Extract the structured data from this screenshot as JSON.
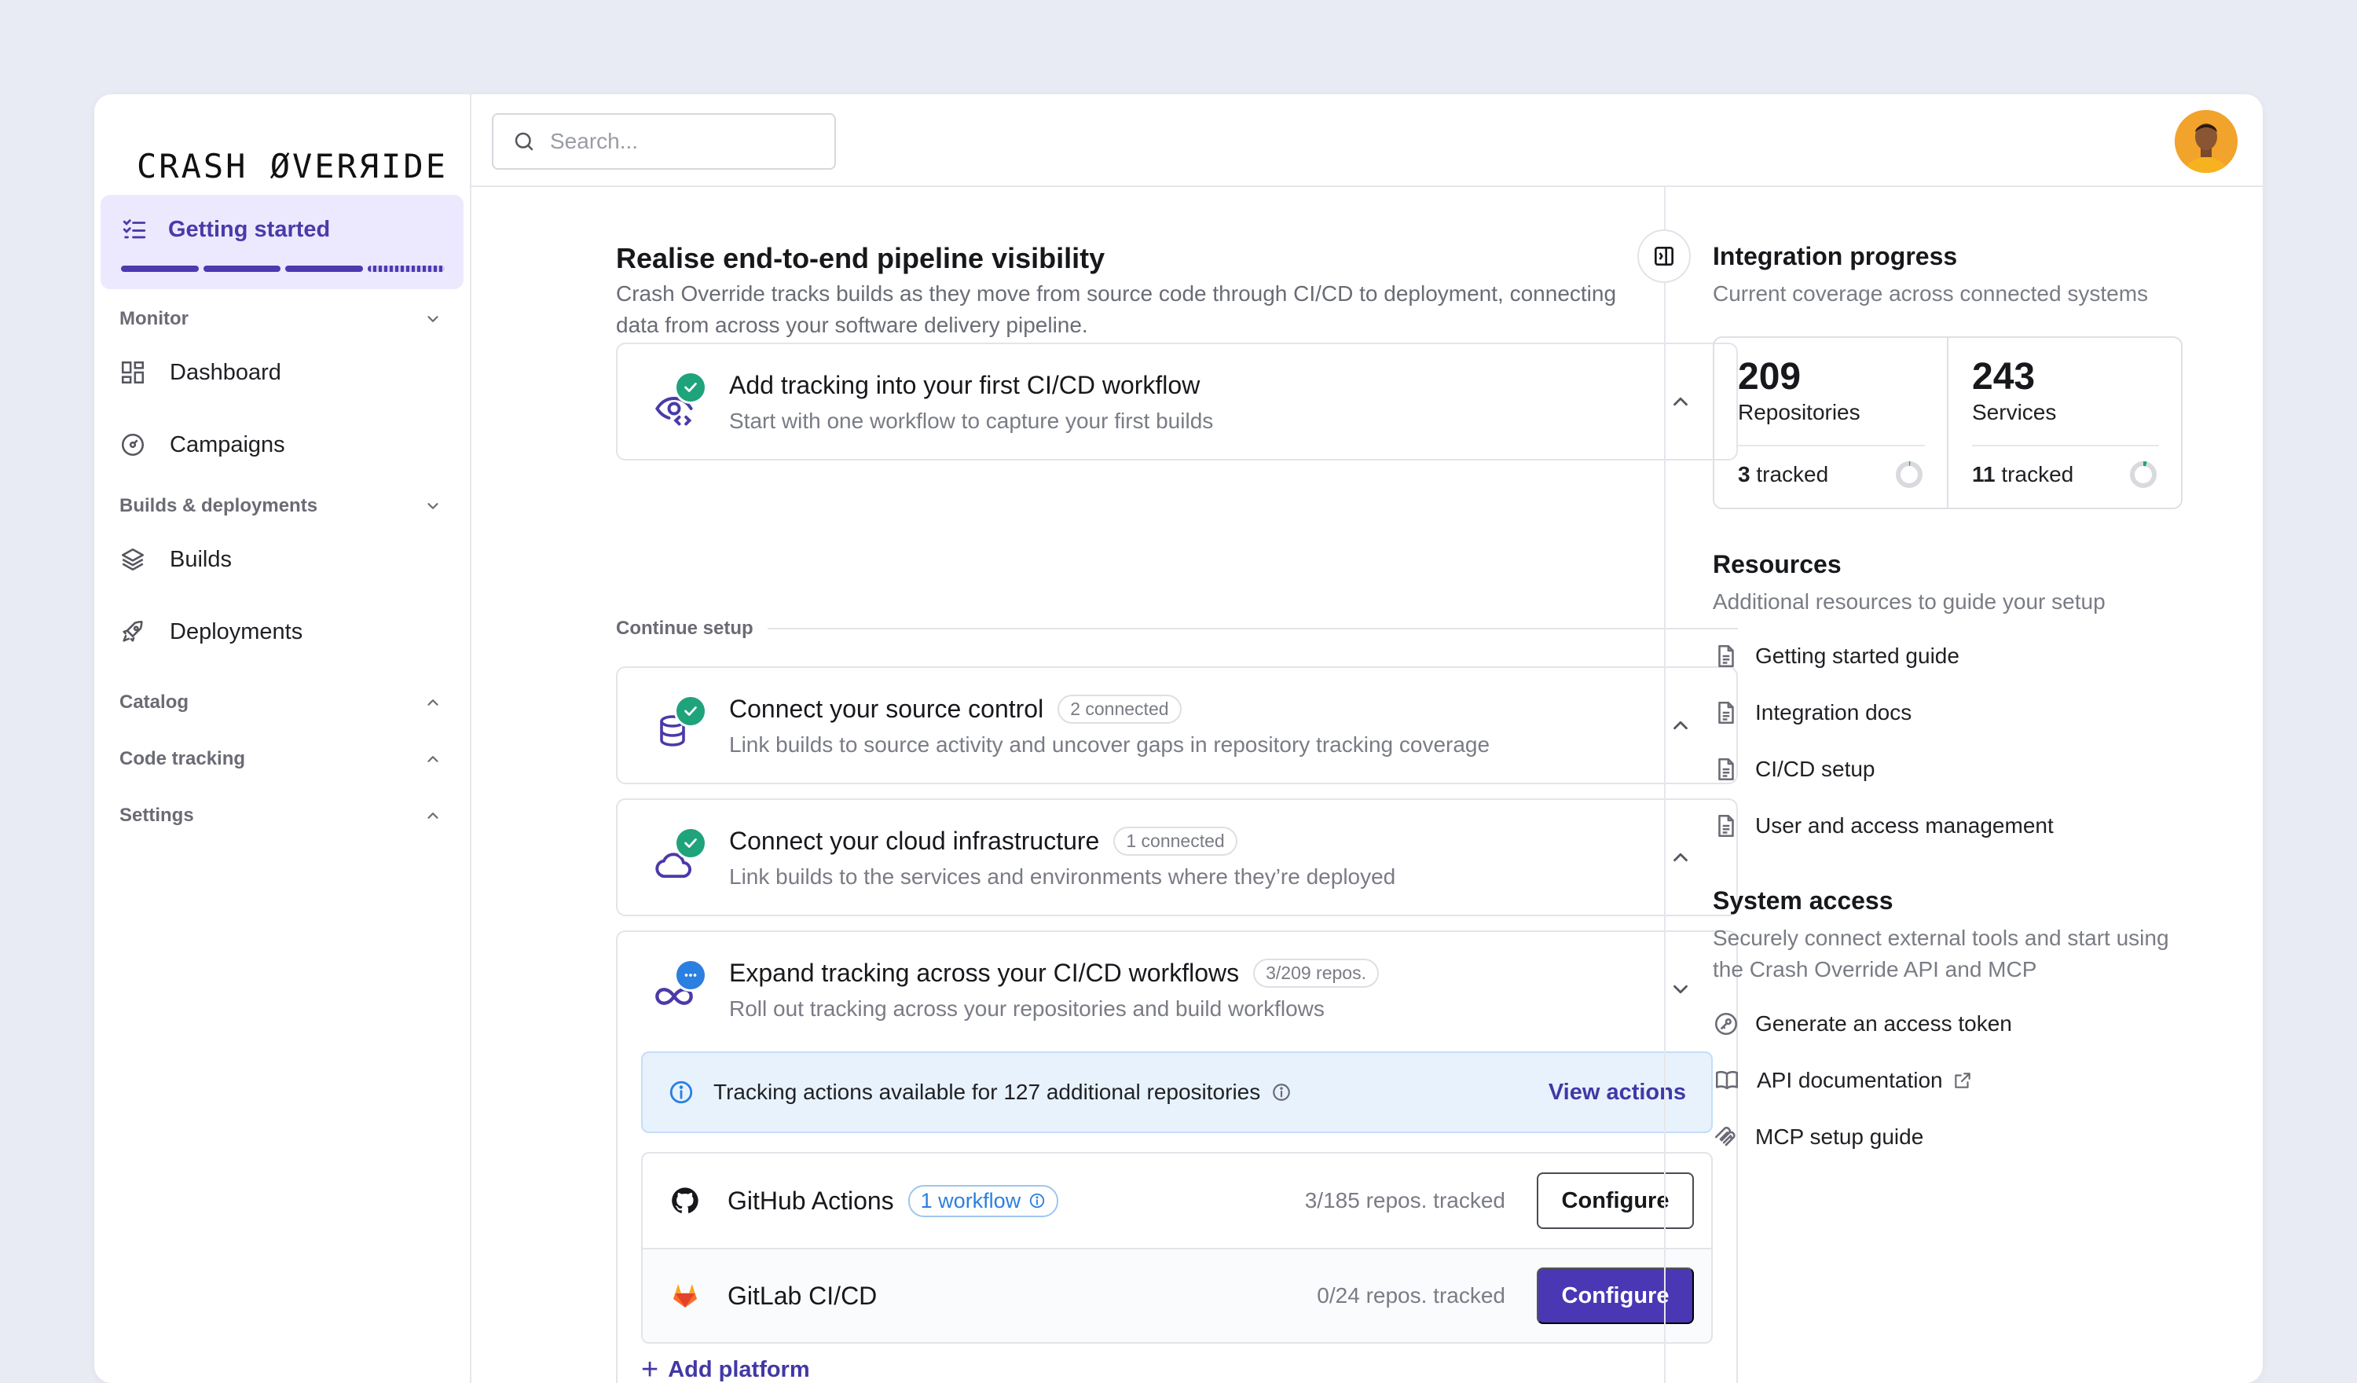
{
  "brand": "CRASH ØVERЯIDE",
  "sidebar": {
    "getting_started": "Getting started",
    "progress": {
      "completed_segments": 3,
      "total_segments": 4
    },
    "sections": [
      {
        "label": "Monitor",
        "items": [
          "Dashboard",
          "Campaigns"
        ]
      },
      {
        "label": "Builds & deployments",
        "items": [
          "Builds",
          "Deployments"
        ]
      },
      {
        "label": "Catalog"
      },
      {
        "label": "Code tracking"
      },
      {
        "label": "Settings"
      }
    ]
  },
  "search": {
    "placeholder": "Search..."
  },
  "main": {
    "title": "Realise end-to-end pipeline visibility",
    "description": "Crash Override tracks builds as they move from source code through CI/CD to deployment, connecting data from across your software delivery pipeline.",
    "first_step": {
      "title": "Add tracking into your first CI/CD workflow",
      "subtitle": "Start with one workflow to capture your first builds"
    },
    "continue_label": "Continue setup",
    "steps": [
      {
        "title": "Connect your source control",
        "badge": "2 connected",
        "subtitle": "Link builds to source activity and uncover gaps in repository tracking coverage"
      },
      {
        "title": "Connect your cloud infrastructure",
        "badge": "1 connected",
        "subtitle": "Link builds to the services and environments where they’re deployed"
      },
      {
        "title": "Expand tracking across your CI/CD workflows",
        "badge": "3/209 repos.",
        "subtitle": "Roll out tracking across your repositories and build workflows"
      }
    ],
    "info_banner": {
      "text": "Tracking actions available for 127 additional repositories",
      "link": "View actions"
    },
    "platforms": [
      {
        "name": "GitHub Actions",
        "workflow_badge": "1 workflow",
        "count": "3/185 repos. tracked",
        "button": "Configure"
      },
      {
        "name": "GitLab CI/CD",
        "count": "0/24 repos. tracked",
        "button": "Configure"
      }
    ],
    "add_platform": "Add platform"
  },
  "right": {
    "integration": {
      "title": "Integration progress",
      "subtitle": "Current coverage across connected systems",
      "stats": [
        {
          "value": "209",
          "label": "Repositories",
          "tracked_num": "3",
          "tracked_word": "tracked",
          "fraction": 0.014
        },
        {
          "value": "243",
          "label": "Services",
          "tracked_num": "11",
          "tracked_word": "tracked",
          "fraction": 0.045
        }
      ]
    },
    "resources": {
      "title": "Resources",
      "subtitle": "Additional resources to guide your setup",
      "items": [
        "Getting started guide",
        "Integration docs",
        "CI/CD setup",
        "User and access management"
      ]
    },
    "system_access": {
      "title": "System access",
      "subtitle": "Securely connect external tools and start using the Crash Override API and MCP",
      "items": [
        "Generate an access token",
        "API documentation",
        "MCP setup guide"
      ]
    }
  },
  "colors": {
    "accent": "#4a37b3",
    "success": "#1fa37b",
    "info": "#2b7fe0",
    "sidebar_active_bg": "#ece9ff"
  }
}
